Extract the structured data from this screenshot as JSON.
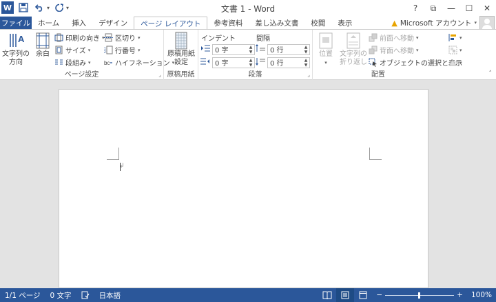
{
  "app": {
    "title": "文書 1 - Word",
    "logo_letter": "W"
  },
  "quick_access": {
    "save_icon": "save-icon",
    "undo_icon": "undo-icon",
    "redo_icon": "redo-icon"
  },
  "window_controls": {
    "help": "?",
    "restore_ribbon": "⧉",
    "minimize": "—",
    "maximize": "☐",
    "close": "✕"
  },
  "tabs": [
    "ファイル",
    "ホーム",
    "挿入",
    "デザイン",
    "ページ レイアウト",
    "参考資料",
    "差し込み文書",
    "校閲",
    "表示"
  ],
  "active_tab": "ページ レイアウト",
  "account": {
    "name": "Microsoft アカウント"
  },
  "ribbon": {
    "page_setup": {
      "label": "ページ設定",
      "text_direction": [
        "文字列の",
        "方向"
      ],
      "margins": "余白",
      "orientation": "印刷の向き",
      "size": "サイズ",
      "columns": "段組み",
      "breaks": "区切り",
      "line_numbers": "行番号",
      "hyphenation": "ハイフネーション"
    },
    "manuscript": {
      "label": "原稿用紙",
      "button": [
        "原稿用紙",
        "設定"
      ]
    },
    "paragraph": {
      "label": "段落",
      "indent_label": "インデント",
      "spacing_label": "間隔",
      "indent_left": "0 字",
      "indent_right": "0 字",
      "spacing_before": "0 行",
      "spacing_after": "0 行"
    },
    "arrange": {
      "label": "配置",
      "position": "位置",
      "wrap_text": [
        "文字列の",
        "折り返し"
      ],
      "bring_forward": "前面へ移動",
      "send_backward": "背面へ移動",
      "selection_pane": "オブジェクトの選択と表示"
    }
  },
  "statusbar": {
    "page": "1/1 ページ",
    "words": "0 文字",
    "language": "日本語",
    "zoom": "100%",
    "zoom_minus": "−",
    "zoom_plus": "+"
  },
  "colors": {
    "accent": "#2b579a",
    "warning": "#e8a400"
  }
}
